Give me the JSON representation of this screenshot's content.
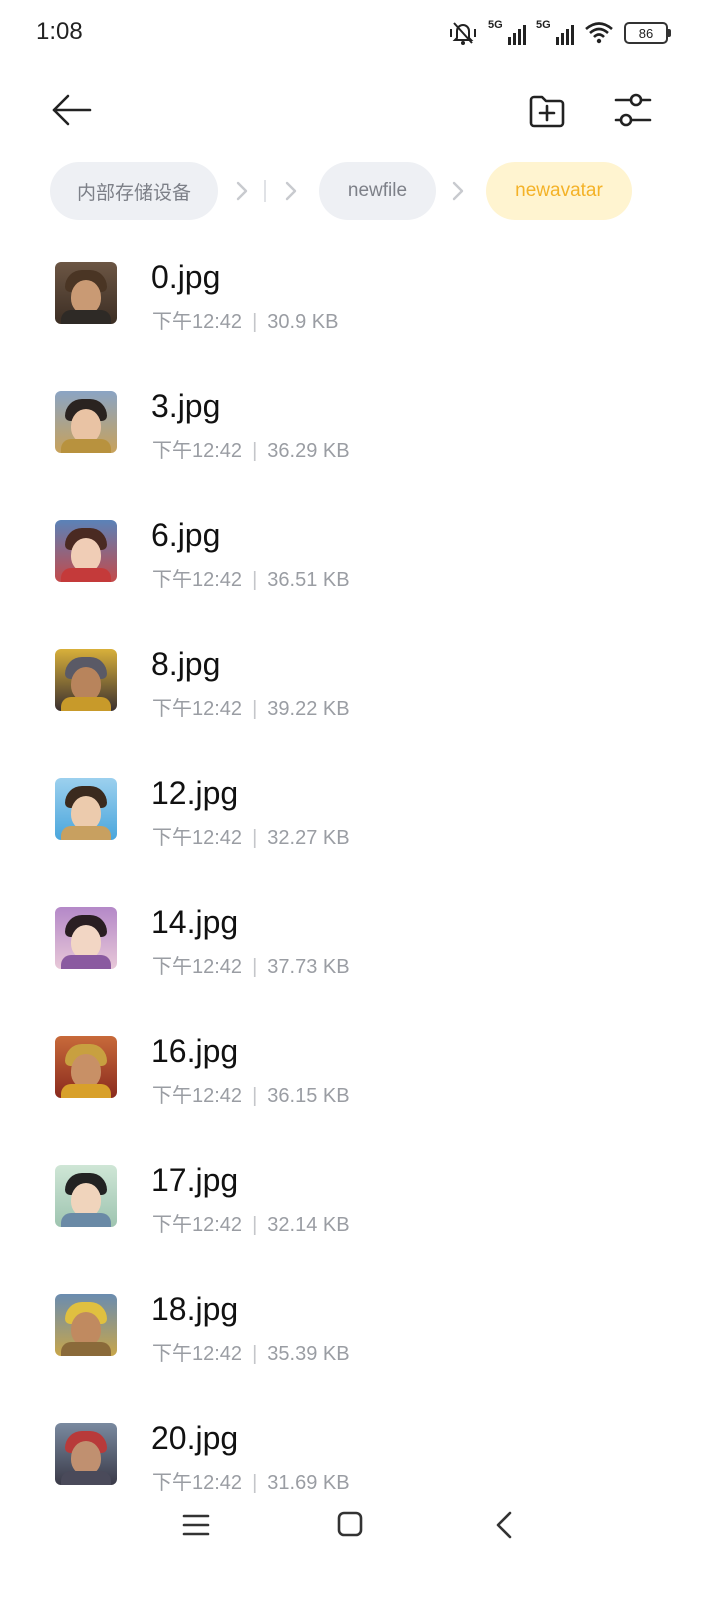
{
  "status_bar": {
    "time": "1:08",
    "net1": "5G",
    "net2": "5G",
    "battery": "86",
    "icons": [
      "mute-vibrate-icon",
      "signal-5g-icon",
      "signal-5g-icon",
      "wifi-icon",
      "battery-icon"
    ]
  },
  "header": {
    "back_icon": "arrow-left-icon",
    "new_folder_icon": "folder-plus-icon",
    "filter_icon": "sliders-icon"
  },
  "breadcrumbs": [
    {
      "label": "内部存储设备",
      "active": false
    },
    {
      "label": "newfile",
      "active": false
    },
    {
      "label": "newavatar",
      "active": true
    }
  ],
  "files": [
    {
      "name": "0.jpg",
      "time": "下午12:42",
      "size": "30.9 KB"
    },
    {
      "name": "3.jpg",
      "time": "下午12:42",
      "size": "36.29 KB"
    },
    {
      "name": "6.jpg",
      "time": "下午12:42",
      "size": "36.51 KB"
    },
    {
      "name": "8.jpg",
      "time": "下午12:42",
      "size": "39.22 KB"
    },
    {
      "name": "12.jpg",
      "time": "下午12:42",
      "size": "32.27 KB"
    },
    {
      "name": "14.jpg",
      "time": "下午12:42",
      "size": "37.73 KB"
    },
    {
      "name": "16.jpg",
      "time": "下午12:42",
      "size": "36.15 KB"
    },
    {
      "name": "17.jpg",
      "time": "下午12:42",
      "size": "32.14 KB"
    },
    {
      "name": "18.jpg",
      "time": "下午12:42",
      "size": "35.39 KB"
    },
    {
      "name": "20.jpg",
      "time": "下午12:42",
      "size": "31.69 KB"
    }
  ],
  "colors": {
    "accent": "#f4b227",
    "accent_bg": "#fff4d0",
    "chip_bg": "#eef0f4",
    "chip_text": "#7d8088",
    "meta_text": "#9a9da3"
  },
  "nav_bar": {
    "icons": [
      "menu-icon",
      "home-square-icon",
      "back-chevron-icon"
    ]
  }
}
